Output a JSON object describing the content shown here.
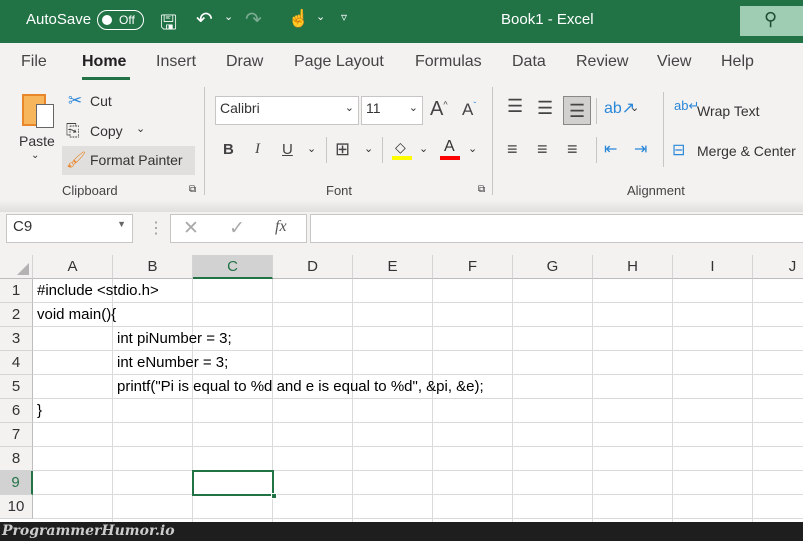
{
  "title_bar": {
    "autosave_label": "AutoSave",
    "autosave_state": "Off",
    "title": "Book1  -  Excel",
    "icons": [
      "save-icon",
      "undo-icon",
      "redo-icon",
      "touch-mode-icon",
      "customize-icon",
      "search-icon"
    ]
  },
  "tabs": [
    "File",
    "Home",
    "Insert",
    "Draw",
    "Page Layout",
    "Formulas",
    "Data",
    "Review",
    "View",
    "Help"
  ],
  "active_tab": "Home",
  "clipboard": {
    "paste": "Paste",
    "cut": "Cut",
    "copy": "Copy",
    "format_painter": "Format Painter",
    "group": "Clipboard"
  },
  "font": {
    "name": "Calibri",
    "size": "11",
    "group": "Font",
    "highlight_color": "#ffff00",
    "font_color": "#ff0000",
    "bold": "B",
    "italic": "I",
    "underline": "U"
  },
  "alignment": {
    "wrap_text": "Wrap Text",
    "merge_center": "Merge & Center",
    "group": "Alignment"
  },
  "formula_bar": {
    "name_box": "C9",
    "fx": "fx",
    "value": ""
  },
  "columns": [
    "A",
    "B",
    "C",
    "D",
    "E",
    "F",
    "G",
    "H",
    "I",
    "J"
  ],
  "rows": [
    "1",
    "2",
    "3",
    "4",
    "5",
    "6",
    "7",
    "8",
    "9",
    "10"
  ],
  "selected_cell": "C9",
  "cells": [
    {
      "ref": "A1",
      "text": "#include <stdio.h>"
    },
    {
      "ref": "A2",
      "text": "void main(){"
    },
    {
      "ref": "B3",
      "text": "int piNumber = 3;"
    },
    {
      "ref": "B4",
      "text": "int eNumber = 3;"
    },
    {
      "ref": "B5",
      "text": "printf(\"Pi is equal to %d and e is equal to %d\", &pi, &e);"
    },
    {
      "ref": "A6",
      "text": "}"
    }
  ],
  "watermark": "ProgrammerHumor.io",
  "accent": "#217346"
}
